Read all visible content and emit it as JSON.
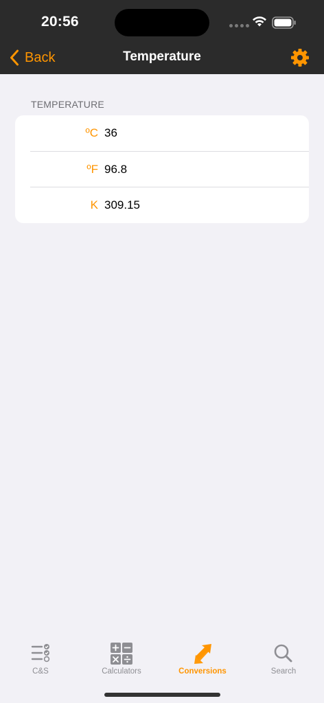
{
  "status_bar": {
    "time": "20:56",
    "wifi_icon": "wifi-icon",
    "battery_icon": "battery-icon"
  },
  "nav": {
    "back_label": "Back",
    "title": "Temperature",
    "settings_icon": "gear-icon",
    "accent": "#ff9500"
  },
  "section": {
    "header": "TEMPERATURE"
  },
  "rows": [
    {
      "unit": "ºC",
      "value": "36"
    },
    {
      "unit": "ºF",
      "value": "96.8"
    },
    {
      "unit": "K",
      "value": "309.15"
    }
  ],
  "tabs": [
    {
      "label": "C&S",
      "icon": "checklist-icon",
      "active": false
    },
    {
      "label": "Calculators",
      "icon": "calculator-icon",
      "active": false
    },
    {
      "label": "Conversions",
      "icon": "conversion-arrows-icon",
      "active": true
    },
    {
      "label": "Search",
      "icon": "search-icon",
      "active": false
    }
  ]
}
